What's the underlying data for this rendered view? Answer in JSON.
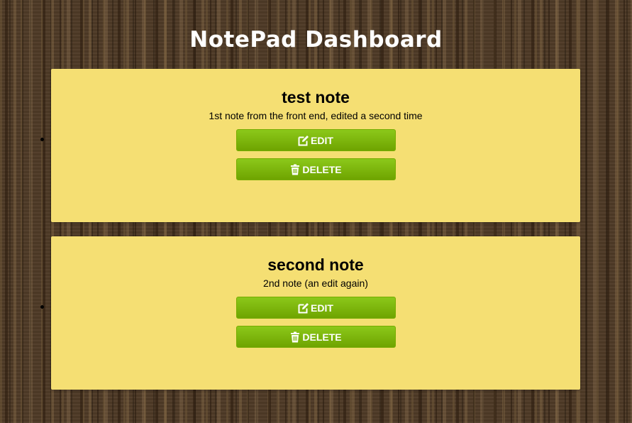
{
  "header": {
    "title": "NotePad Dashboard"
  },
  "notes": [
    {
      "title": "test note",
      "body": "1st note from the front end, edited a second time",
      "edit_label": "EDIT",
      "delete_label": "DELETE"
    },
    {
      "title": "second note",
      "body": "2nd note (an edit again)",
      "edit_label": "EDIT",
      "delete_label": "DELETE"
    }
  ],
  "icons": {
    "edit": "edit-icon",
    "delete": "trash-icon"
  },
  "colors": {
    "card": "#f5df73",
    "button": "#7bb80c",
    "title": "#ffffff"
  }
}
